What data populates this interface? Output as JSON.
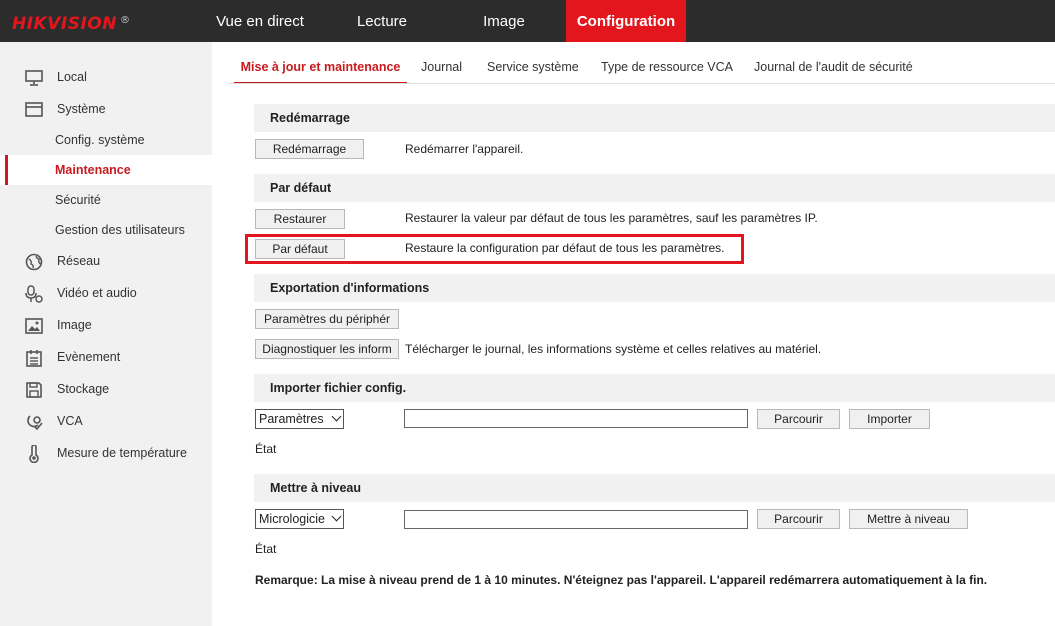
{
  "brand": {
    "name": "HIKVISION",
    "mark": "®",
    "color": "#e3161d"
  },
  "topnav": {
    "items": [
      {
        "label": "Vue en direct"
      },
      {
        "label": "Lecture"
      },
      {
        "label": "Image"
      },
      {
        "label": "Configuration",
        "active": true
      }
    ]
  },
  "sidebar": {
    "items": [
      {
        "label": "Local",
        "icon": "monitor-icon"
      },
      {
        "label": "Système",
        "icon": "system-window-icon"
      },
      {
        "label": "Config. système",
        "sub": true
      },
      {
        "label": "Maintenance",
        "sub": true,
        "active": true
      },
      {
        "label": "Sécurité",
        "sub": true
      },
      {
        "label": "Gestion des utilisateurs",
        "sub": true
      },
      {
        "label": "Réseau",
        "icon": "globe-icon"
      },
      {
        "label": "Vidéo et audio",
        "icon": "microphone-camera-icon"
      },
      {
        "label": "Image",
        "icon": "image-icon"
      },
      {
        "label": "Evènement",
        "icon": "calendar-icon"
      },
      {
        "label": "Stockage",
        "icon": "floppy-disk-icon"
      },
      {
        "label": "VCA",
        "icon": "vca-icon"
      },
      {
        "label": "Mesure de température",
        "icon": "thermometer-icon"
      }
    ]
  },
  "tabs": [
    {
      "label": "Mise à jour et maintenance",
      "active": true
    },
    {
      "label": "Journal"
    },
    {
      "label": "Service système"
    },
    {
      "label": "Type de ressource VCA"
    },
    {
      "label": "Journal de l'audit de sécurité"
    }
  ],
  "sections": {
    "reboot": {
      "title": "Redémarrage",
      "button": "Redémarrage",
      "desc": "Redémarrer l'appareil."
    },
    "default": {
      "title": "Par défaut",
      "restore_button": "Restaurer",
      "restore_desc": "Restaurer la valeur par défaut de tous les paramètres, sauf les paramètres IP.",
      "default_button": "Par défaut",
      "default_desc": "Restaure la configuration par défaut de tous les paramètres."
    },
    "export": {
      "title": "Exportation d'informations",
      "params_button": "Paramètres du périphér",
      "diag_button": "Diagnostiquer les inform",
      "diag_desc": "Télécharger le journal, les informations système et celles relatives au matériel."
    },
    "import": {
      "title": "Importer fichier config.",
      "select_value": "Paramètres",
      "browse_button": "Parcourir",
      "import_button": "Importer",
      "status_label": "État"
    },
    "upgrade": {
      "title": "Mettre à niveau",
      "select_value": "Micrologicie",
      "browse_button": "Parcourir",
      "upgrade_button": "Mettre à niveau",
      "status_label": "État",
      "remark": "Remarque: La mise à niveau prend de 1 à 10 minutes. N'éteignez pas l'appareil. L'appareil redémarrera automatiquement à la fin."
    }
  },
  "highlight_color": "#e3161d"
}
